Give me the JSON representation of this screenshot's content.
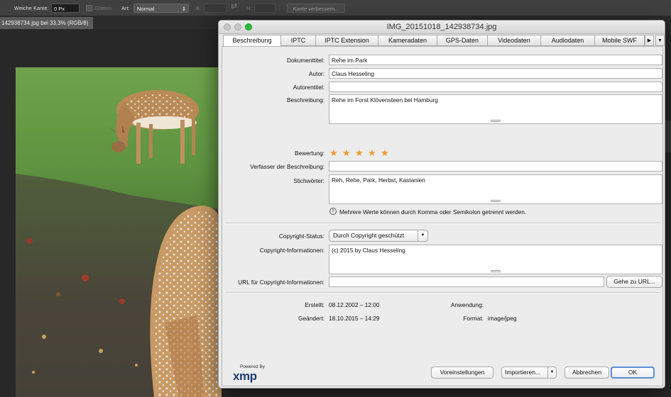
{
  "options_bar": {
    "feather_label": "Weiche Kante:",
    "feather_value": "0 Px",
    "antialias_label": "Glätten",
    "style_label": "Art:",
    "style_value": "Normal",
    "width_label": "B:",
    "height_label": "H:",
    "refine_edge_button": "Kante verbessern..."
  },
  "document_tab": {
    "title": "142938734.jpg bei 33,3% (RGB/8)"
  },
  "dialog": {
    "title": "IMG_20151018_142938734.jpg",
    "tabs": [
      "Beschreibung",
      "IPTC",
      "IPTC Extension",
      "Kameradaten",
      "GPS-Daten",
      "Videodaten",
      "Audiodaten",
      "Mobile SWF"
    ],
    "active_tab": "Beschreibung",
    "fields": {
      "document_title": {
        "label": "Dokumenttitel:",
        "value": "Rehe im Park"
      },
      "author": {
        "label": "Autor:",
        "value": "Claus Hesseling"
      },
      "author_title": {
        "label": "Autorentitel:",
        "value": ""
      },
      "description": {
        "label": "Beschreibung:",
        "value": "Rehe im Forst Klövensteen bei Hamburg"
      },
      "rating": {
        "label": "Bewertung:",
        "stars": 5,
        "max": 5
      },
      "description_writer": {
        "label": "Verfasser der Beschreibung:",
        "value": ""
      },
      "keywords": {
        "label": "Stichwörter:",
        "value": "Reh, Rehe, Park, Herbst, Kastanien"
      },
      "keywords_hint": "Mehrere Werte können durch Komma oder Semikolon getrennt werden.",
      "copyright_status": {
        "label": "Copyright-Status:",
        "value": "Durch Copyright geschützt"
      },
      "copyright_info": {
        "label": "Copyright-Informationen:",
        "value": "(c) 2015 by Claus Hesseling"
      },
      "copyright_url": {
        "label": "URL für Copyright-Informationen:",
        "value": "",
        "button": "Gehe zu URL..."
      }
    },
    "meta": {
      "created_label": "Erstellt:",
      "created_value": "08.12.2002 – 12:00",
      "modified_label": "Geändert:",
      "modified_value": "18.10.2015 – 14:29",
      "application_label": "Anwendung:",
      "application_value": "",
      "format_label": "Format:",
      "format_value": "image/jpeg"
    },
    "footer": {
      "powered_by": "Powered By",
      "xmp_logo": "xmp",
      "preferences_button": "Voreinstellungen",
      "import_button": "Importieren...",
      "cancel_button": "Abbrechen",
      "ok_button": "OK"
    },
    "colors": {
      "star": "#ef9b2e",
      "ok_border": "#5b8fd6",
      "close_light": "#c6c6c6",
      "zoom_light": "#2fb83a"
    }
  }
}
